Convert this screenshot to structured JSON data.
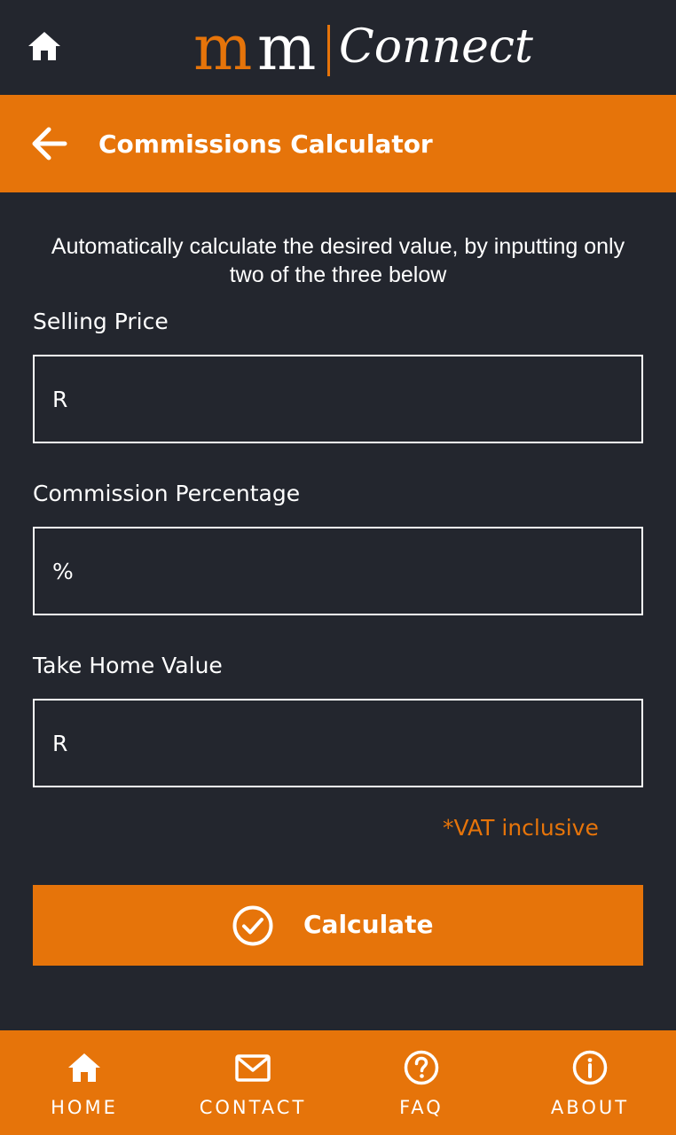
{
  "topbar": {
    "home_icon": "home-icon",
    "logo": {
      "mark_orange": "m",
      "mark_white": "m",
      "wordmark": "Connect"
    }
  },
  "header": {
    "back_icon": "arrow-left-icon",
    "title": "Commissions Calculator"
  },
  "main": {
    "intro": "Automatically calculate the desired value, by inputting only two of the three below",
    "fields": [
      {
        "label": "Selling Price",
        "placeholder": "R",
        "value": ""
      },
      {
        "label": "Commission Percentage",
        "placeholder": "%",
        "value": ""
      },
      {
        "label": "Take Home Value",
        "placeholder": "R",
        "value": ""
      }
    ],
    "vat_note": "*VAT inclusive",
    "calculate": {
      "icon": "check-circle-icon",
      "label": "Calculate"
    }
  },
  "bottom_nav": {
    "items": [
      {
        "label": "HOME",
        "icon": "home-icon"
      },
      {
        "label": "CONTACT",
        "icon": "mail-icon"
      },
      {
        "label": "FAQ",
        "icon": "question-circle-icon"
      },
      {
        "label": "ABOUT",
        "icon": "info-circle-icon"
      }
    ]
  },
  "colors": {
    "background": "#23262e",
    "accent": "#e6740a",
    "text": "#ffffff"
  }
}
